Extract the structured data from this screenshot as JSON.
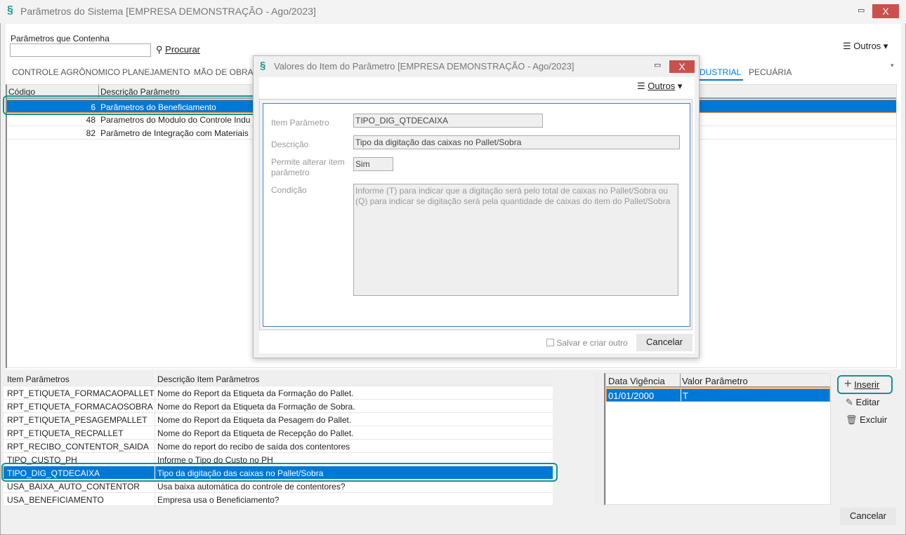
{
  "window": {
    "title": "Parâmetros do Sistema [EMPRESA DEMONSTRAÇÃO - Ago/2023]",
    "minimize": "▭",
    "close": "X"
  },
  "search": {
    "label": "Parâmetros que Contenha",
    "value": "",
    "button": "Procurar"
  },
  "outros": "Outros",
  "tabs": [
    "CONTROLE AGRÔNOMICO",
    "PLANEJAMENTO",
    "MÃO DE OBRA",
    "DUSTRIAL",
    "PECUÁRIA"
  ],
  "params_grid": {
    "headers": [
      "Código",
      "Descrição Parâmetro"
    ],
    "rows": [
      {
        "code": "6",
        "desc": "Parâmetros do Beneficiamento"
      },
      {
        "code": "48",
        "desc": "Parametros do Modulo do Controle Indu"
      },
      {
        "code": "82",
        "desc": "Parâmetro de Integração com Materiais"
      }
    ]
  },
  "items_grid": {
    "headers": [
      "Item Parâmetros",
      "Descrição Item Parâmetros"
    ],
    "rows": [
      {
        "item": "RPT_ETIQUETA_FORMACAOPALLET",
        "desc": "Nome do Report da Etiqueta da Formação do Pallet."
      },
      {
        "item": "RPT_ETIQUETA_FORMACAOSOBRA",
        "desc": "Nome do Report da Etiqueta da Formação de Sobra."
      },
      {
        "item": "RPT_ETIQUETA_PESAGEMPALLET",
        "desc": "Nome do Report da Etiqueta da Pesagem do Pallet."
      },
      {
        "item": "RPT_ETIQUETA_RECPALLET",
        "desc": "Nome do Report da Etiqueta de Recepção do Pallet."
      },
      {
        "item": "RPT_RECIBO_CONTENTOR_SAIDA",
        "desc": "Nome do report do recibo de saída dos contentores"
      },
      {
        "item": "TIPO_CUSTO_PH",
        "desc": "Informe o Tipo do Custo no PH"
      },
      {
        "item": "TIPO_DIG_QTDECAIXA",
        "desc": "Tipo da digitação das caixas no Pallet/Sobra"
      },
      {
        "item": "USA_BAIXA_AUTO_CONTENTOR",
        "desc": "Usa baixa automática do controle de contentores?"
      },
      {
        "item": "USA_BENEFICIAMENTO",
        "desc": "Empresa usa o Beneficiamento?"
      }
    ]
  },
  "values_grid": {
    "headers": [
      "Data Vigência",
      "Valor Parâmetro"
    ],
    "rows": [
      {
        "date": "01/01/2000",
        "value": "T"
      }
    ]
  },
  "actions": {
    "insert": "Inserir",
    "edit": "Editar",
    "delete": "Excluir",
    "cancel": "Cancelar"
  },
  "dialog": {
    "title": "Valores do Item do Parâmetro [EMPRESA DEMONSTRAÇÃO - Ago/2023]",
    "outros": "Outros",
    "item_label": "Item Parâmetro",
    "item_value": "TIPO_DIG_QTDECAIXA",
    "desc_label": "Descrição",
    "desc_value": "Tipo da digitação das caixas no Pallet/Sobra",
    "allow_label": "Permite alterar item parâmetro",
    "allow_value": "Sim",
    "cond_label": "Condição",
    "cond_value": "Informe (T) para indicar que a digitação será pelo total de caixas no Pallet/Sobra ou (Q) para indicar se digitação será pela quantidade de caixas do item do Pallet/Sobra",
    "save_new": "Salvar e criar outro",
    "cancel": "Cancelar"
  }
}
